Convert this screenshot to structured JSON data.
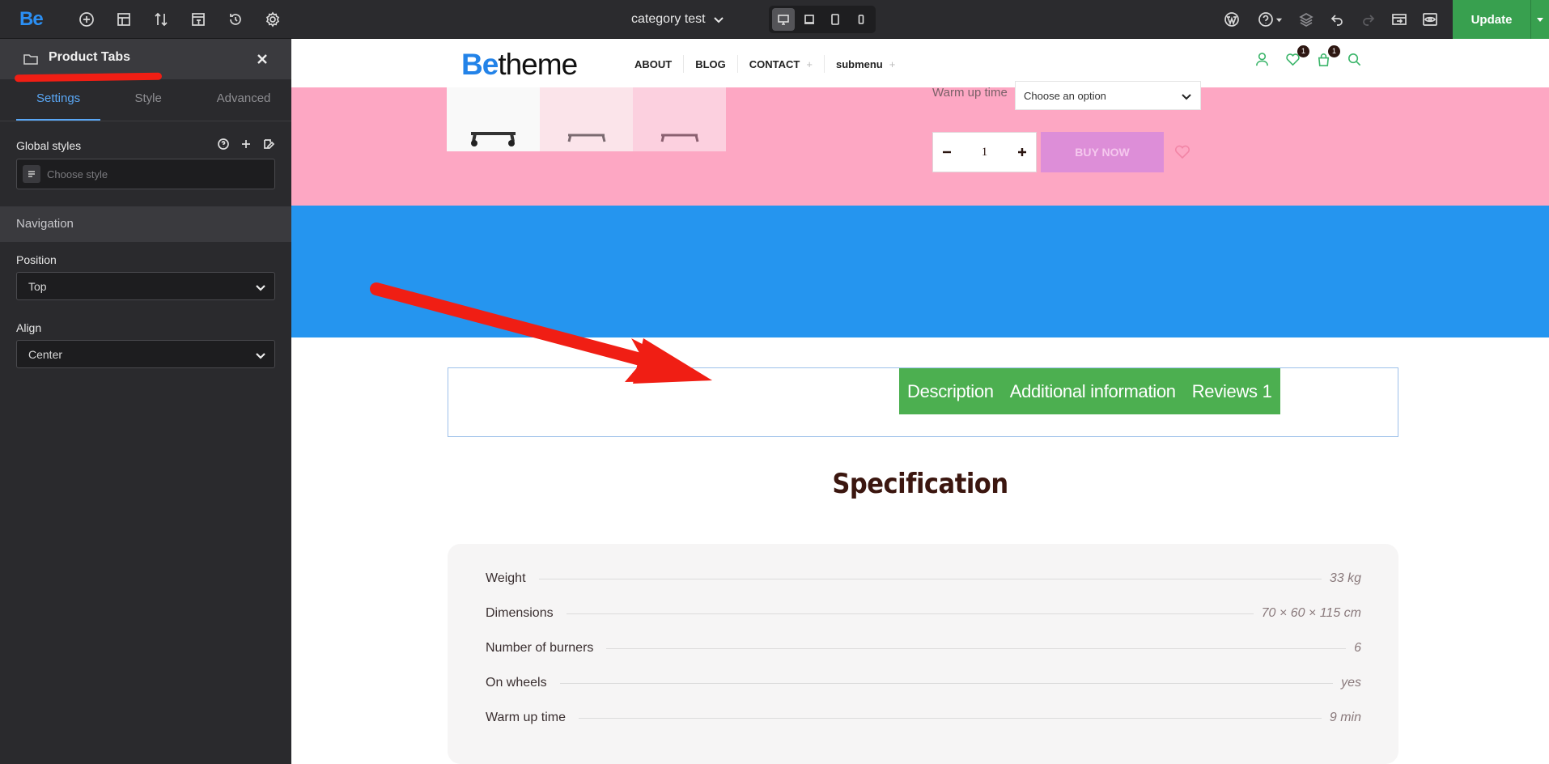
{
  "toolbar": {
    "logo": "Be",
    "page_name": "category test",
    "update_label": "Update"
  },
  "panel": {
    "title": "Product Tabs",
    "tabs": [
      "Settings",
      "Style",
      "Advanced"
    ],
    "active_tab": "Settings",
    "global_styles_label": "Global styles",
    "global_styles_placeholder": "Choose style",
    "section_title": "Navigation",
    "position_label": "Position",
    "position_value": "Top",
    "align_label": "Align",
    "align_value": "Center"
  },
  "site": {
    "logo_be": "Be",
    "logo_rest": "theme",
    "menu": [
      {
        "label": "ABOUT",
        "has_plus": false
      },
      {
        "label": "BLOG",
        "has_plus": false
      },
      {
        "label": "CONTACT",
        "has_plus": true
      },
      {
        "label": "submenu",
        "has_plus": true
      }
    ],
    "wishlist_count": "1",
    "cart_count": "1"
  },
  "product": {
    "warm_up_label": "Warm up time",
    "warm_up_placeholder": "Choose an option",
    "quantity": "1",
    "buy_now": "BUY NOW"
  },
  "product_tabs": {
    "items": [
      "Description",
      "Additional information",
      "Reviews 1"
    ],
    "accent_color": "#4caf50"
  },
  "specification": {
    "title": "Specification",
    "rows": [
      {
        "name": "Weight",
        "value": "33 kg"
      },
      {
        "name": "Dimensions",
        "value": "70 × 60 × 115 cm"
      },
      {
        "name": "Number of burners",
        "value": "6"
      },
      {
        "name": "On wheels",
        "value": "yes"
      },
      {
        "name": "Warm up time",
        "value": "9 min"
      }
    ]
  },
  "colors": {
    "pink_section": "#fda7c3",
    "blue_section": "#2595ef",
    "update_green": "#38a04f",
    "annotation_red": "#f01e14"
  }
}
